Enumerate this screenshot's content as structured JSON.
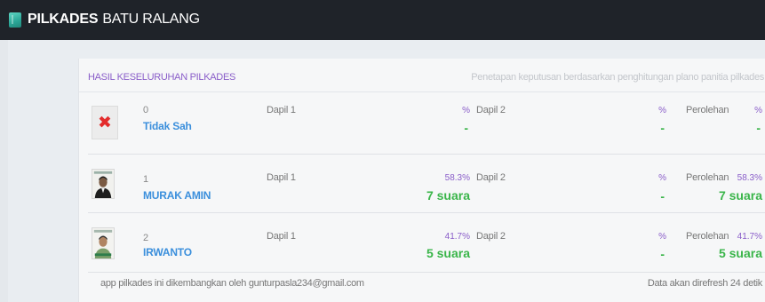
{
  "app": {
    "brand_bold": "PILKADES",
    "brand_light": "BATU RALANG"
  },
  "panel": {
    "title": "HASIL KESELURUHAN PILKADES",
    "note": "Penetapan keputusan berdasarkan penghitungan plano panitia pilkades"
  },
  "labels": {
    "dapil1": "Dapil 1",
    "dapil2": "Dapil 2",
    "perolehan": "Perolehan",
    "pct": "%",
    "dash": "-"
  },
  "rows": [
    {
      "number": "0",
      "name": "Tidak Sah",
      "icon": "invalid-x-icon",
      "dapil1_pct": "%",
      "dapil1_votes": "-",
      "dapil2_pct": "%",
      "dapil2_votes": "-",
      "total_pct": "%",
      "total_votes": "-"
    },
    {
      "number": "1",
      "name": "MURAK AMIN",
      "icon": "candidate-photo",
      "dapil1_pct": "58.3%",
      "dapil1_votes": "7 suara",
      "dapil2_pct": "%",
      "dapil2_votes": "-",
      "total_pct": "58.3%",
      "total_votes": "7 suara"
    },
    {
      "number": "2",
      "name": "IRWANTO",
      "icon": "candidate-photo",
      "dapil1_pct": "41.7%",
      "dapil1_votes": "5 suara",
      "dapil2_pct": "%",
      "dapil2_votes": "-",
      "total_pct": "41.7%",
      "total_votes": "5 suara"
    }
  ],
  "footer": {
    "credit": "app pilkades ini dikembangkan oleh gunturpasla234@gmail.com",
    "refresh": "Data akan direfresh 24 detik"
  },
  "colors": {
    "accent_purple": "#8a5ec9",
    "name_blue": "#3b8fdc",
    "vote_green": "#3ab54a",
    "topbar": "#1f2329"
  }
}
